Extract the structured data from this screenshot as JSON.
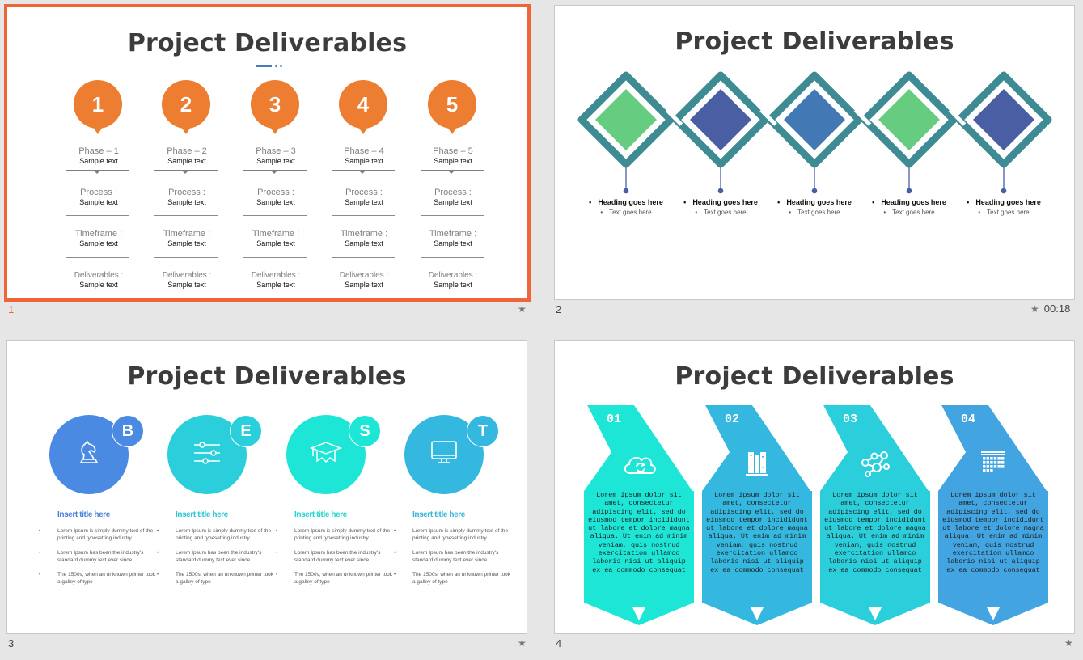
{
  "app": {
    "view": "Slide Sorter",
    "selected_slide": 1
  },
  "slides": [
    {
      "number": "1",
      "title": "Project Deliverables",
      "has_animation_star": true,
      "timing": "",
      "phases": [
        {
          "badge": "1",
          "phase": "Phase – 1",
          "phase_text": "Sample text",
          "process_label": "Process :",
          "process_text": "Sample text",
          "timeframe_label": "Timeframe :",
          "timeframe_text": "Sample text",
          "deliverables_label": "Deliverables :",
          "deliverables_text": "Sample text"
        },
        {
          "badge": "2",
          "phase": "Phase – 2",
          "phase_text": "Sample text",
          "process_label": "Process :",
          "process_text": "Sample text",
          "timeframe_label": "Timeframe :",
          "timeframe_text": "Sample text",
          "deliverables_label": "Deliverables :",
          "deliverables_text": "Sample text"
        },
        {
          "badge": "3",
          "phase": "Phase – 3",
          "phase_text": "Sample text",
          "process_label": "Process :",
          "process_text": "Sample text",
          "timeframe_label": "Timeframe :",
          "timeframe_text": "Sample text",
          "deliverables_label": "Deliverables :",
          "deliverables_text": "Sample text"
        },
        {
          "badge": "4",
          "phase": "Phase – 4",
          "phase_text": "Sample text",
          "process_label": "Process :",
          "process_text": "Sample text",
          "timeframe_label": "Timeframe :",
          "timeframe_text": "Sample text",
          "deliverables_label": "Deliverables :",
          "deliverables_text": "Sample text"
        },
        {
          "badge": "5",
          "phase": "Phase – 5",
          "phase_text": "Sample text",
          "process_label": "Process :",
          "process_text": "Sample text",
          "timeframe_label": "Timeframe :",
          "timeframe_text": "Sample text",
          "deliverables_label": "Deliverables :",
          "deliverables_text": "Sample text"
        }
      ],
      "colors": {
        "pin": "#ed7d31",
        "accent": "#4a7ab8"
      }
    },
    {
      "number": "2",
      "title": "Project Deliverables",
      "has_animation_star": true,
      "timing": "00:18",
      "items": [
        {
          "heading": "Heading goes here",
          "text": "Text goes here",
          "fill": "#66cc80"
        },
        {
          "heading": "Heading goes here",
          "text": "Text goes here",
          "fill": "#4a5fa3"
        },
        {
          "heading": "Heading goes here",
          "text": "Text goes here",
          "fill": "#4279b5"
        },
        {
          "heading": "Heading goes here",
          "text": "Text goes here",
          "fill": "#66cc80"
        },
        {
          "heading": "Heading goes here",
          "text": "Text goes here",
          "fill": "#4a5fa3"
        }
      ],
      "colors": {
        "frame": "#3e8b94",
        "connector": "#4a5fa3"
      }
    },
    {
      "number": "3",
      "title": "Project Deliverables",
      "has_animation_star": true,
      "timing": "",
      "items": [
        {
          "letter": "B",
          "icon": "chess-knight-icon",
          "title": "Insert title here",
          "color": "#4b8ae3",
          "title_color": "#4b82d8",
          "bullets": [
            "Lorem Ipsum is simply dummy text of the printing and typesetting industry.",
            "Lorem Ipsum has been the industry's standard dummy text ever since.",
            "The 1500s, when an unknown printer took a galley of type"
          ]
        },
        {
          "letter": "E",
          "icon": "sliders-icon",
          "title": "Insert title here",
          "color": "#2bcfdc",
          "title_color": "#2bc6d6",
          "bullets": [
            "Lorem Ipsum is simply dummy text of the printing and typesetting industry.",
            "Lorem Ipsum has been the industry's standard dummy text ever since.",
            "The 1500s, when an unknown printer took a galley of type"
          ]
        },
        {
          "letter": "S",
          "icon": "graduation-cap-icon",
          "title": "Insert title here",
          "color": "#1de6d7",
          "title_color": "#1fd6d0",
          "bullets": [
            "Lorem Ipsum is simply dummy text of the printing and typesetting industry.",
            "Lorem Ipsum has been the industry's standard dummy text ever since.",
            "The 1500s, when an unknown printer took a galley of type"
          ]
        },
        {
          "letter": "T",
          "icon": "monitor-icon",
          "title": "Insert title here",
          "color": "#35b8e0",
          "title_color": "#34b4dc",
          "bullets": [
            "Lorem Ipsum is simply dummy text of the printing and typesetting industry.",
            "Lorem Ipsum has been the industry's standard dummy text ever since.",
            "The 1500s, when an unknown printer took a galley of type"
          ]
        }
      ]
    },
    {
      "number": "4",
      "title": "Project Deliverables",
      "has_animation_star": true,
      "timing": "",
      "items": [
        {
          "num": "01",
          "icon": "cloud-sync-icon",
          "color": "#1de6d7",
          "text": "Lorem ipsum dolor sit amet, consectetur adipiscing elit, sed do eiusmod tempor incididunt ut labore et dolore magna aliqua. Ut enim ad minim veniam, quis nostrud exercitation ullamco laboris nisi ut aliquip ex ea commodo consequat"
        },
        {
          "num": "02",
          "icon": "books-icon",
          "color": "#35b8e0",
          "text": "Lorem ipsum dolor sit amet, consectetur adipiscing elit, sed do eiusmod tempor incididunt ut labore et dolore magna aliqua. Ut enim ad minim veniam, quis nostrud exercitation ullamco laboris nisi ut aliquip ex ea commodo consequat"
        },
        {
          "num": "03",
          "icon": "network-icon",
          "color": "#2bcfdc",
          "text": "Lorem ipsum dolor sit amet, consectetur adipiscing elit, sed do eiusmod tempor incididunt ut labore et dolore magna aliqua. Ut enim ad minim veniam, quis nostrud exercitation ullamco laboris nisi ut aliquip ex ea commodo consequat"
        },
        {
          "num": "04",
          "icon": "calendar-icon",
          "color": "#42a4e0",
          "text": "Lorem ipsum dolor sit amet, consectetur adipiscing elit, sed do eiusmod tempor incididunt ut labore et dolore magna aliqua. Ut enim ad minim veniam, quis nostrud exercitation ullamco laboris nisi ut aliquip ex ea commodo consequat"
        }
      ]
    }
  ]
}
